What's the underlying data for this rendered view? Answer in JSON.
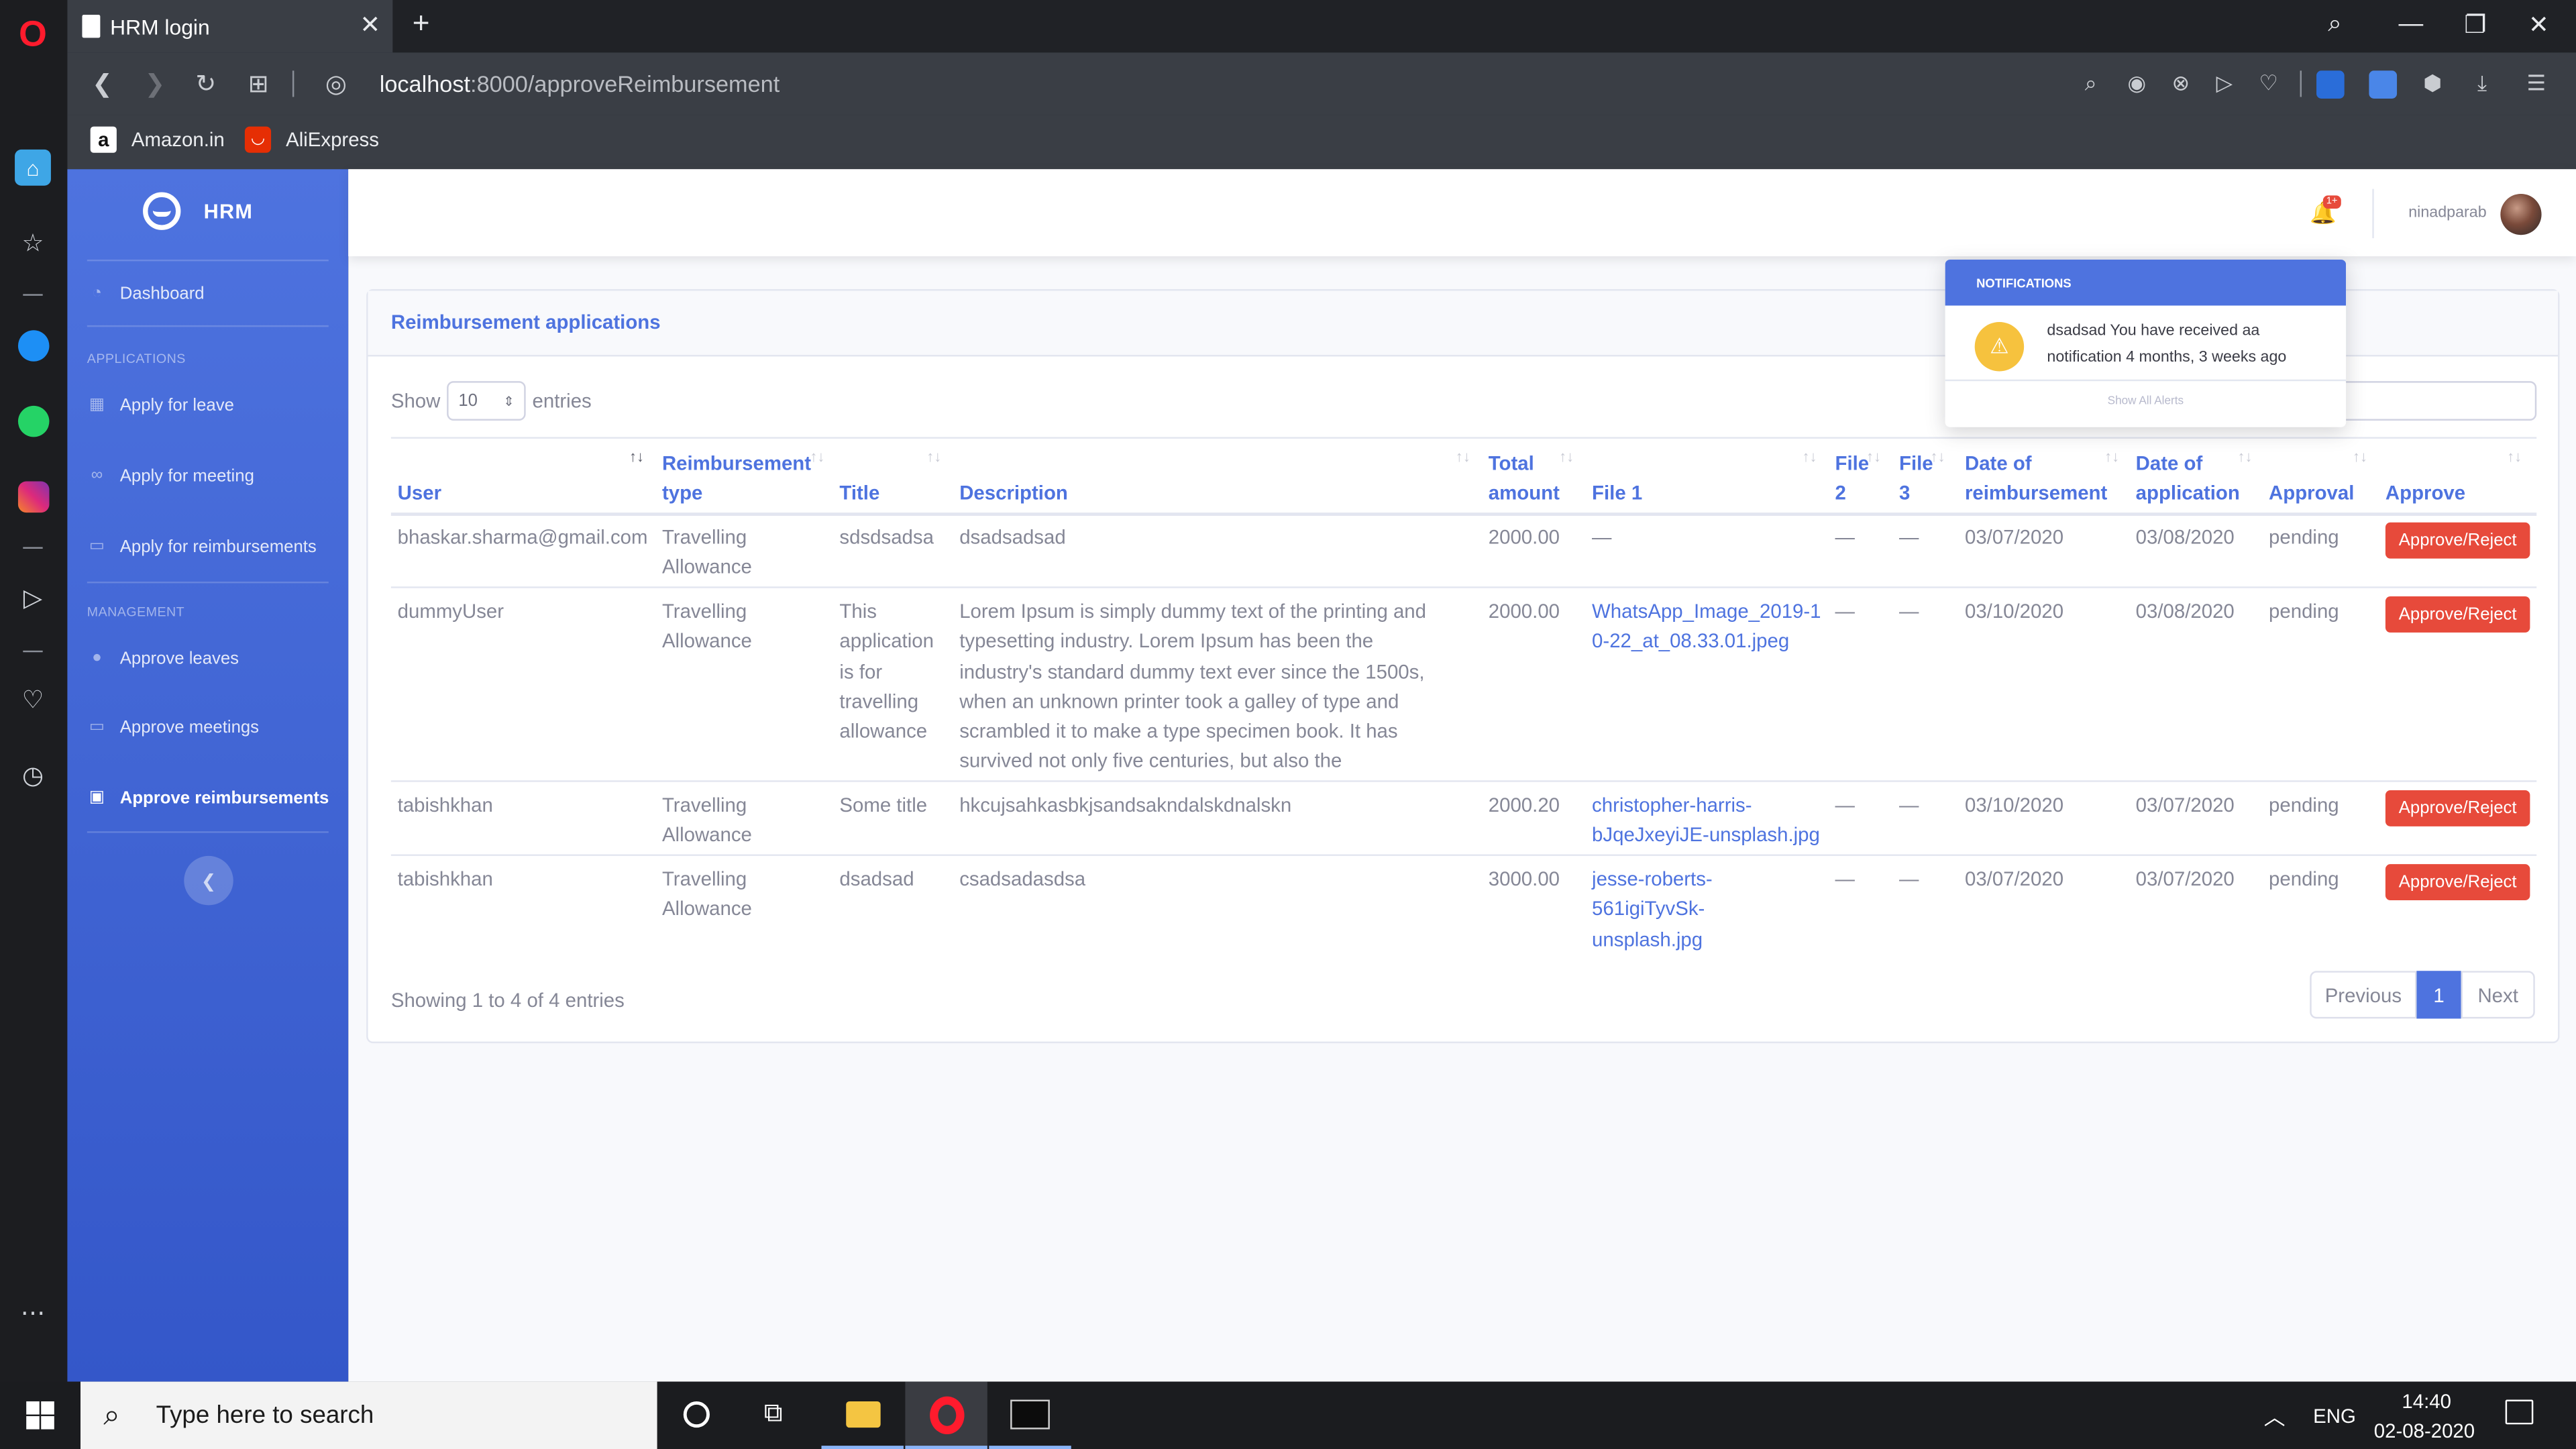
{
  "browser": {
    "tab_title": "HRM login",
    "new_tab": "+",
    "url_host": "localhost",
    "url_path": ":8000/approveReimbursement",
    "bookmarks": [
      {
        "label": "Amazon.in",
        "icon": "amazon-icon"
      },
      {
        "label": "AliExpress",
        "icon": "aliexpress-icon"
      }
    ]
  },
  "app": {
    "brand": "HRM",
    "sidebar": {
      "dashboard": "Dashboard",
      "applications_heading": "APPLICATIONS",
      "apply_leave": "Apply for leave",
      "apply_meeting": "Apply for meeting",
      "apply_reimbursements": "Apply for reimbursements",
      "management_heading": "MANAGEMENT",
      "approve_leaves": "Approve leaves",
      "approve_meetings": "Approve meetings",
      "approve_reimbursements": "Approve reimbursements"
    },
    "topbar": {
      "notification_badge": "1+",
      "username": "ninadparab"
    },
    "notifications": {
      "header": "NOTIFICATIONS",
      "item_text": "dsadsad You have received aa notification 4 months, 3 weeks ago",
      "show_all": "Show All Alerts"
    }
  },
  "page": {
    "card_title": "Reimbursement applications",
    "show_label": "Show",
    "entries_value": "10",
    "entries_label": "entries",
    "columns": {
      "user": "User",
      "type_1": "Reimbursement",
      "type_2": "type",
      "title": "Title",
      "description": "Description",
      "amount_1": "Total",
      "amount_2": "amount",
      "file1": "File 1",
      "file2_1": "File",
      "file2_2": "2",
      "file3_1": "File",
      "file3_2": "3",
      "dor_1": "Date of",
      "dor_2": "reimbursement",
      "doa_1": "Date of",
      "doa_2": "application",
      "approval": "Approval",
      "approve": "Approve"
    },
    "rows": [
      {
        "user": "bhaskar.sharma@gmail.com",
        "type": "Travelling Allowance",
        "title": "sdsdsadsa",
        "description": "dsadsadsad",
        "amount": "2000.00",
        "file1": "—",
        "file2": "—",
        "file3": "—",
        "dor": "03/07/2020",
        "doa": "03/08/2020",
        "approval": "pending",
        "action": "Approve/Reject"
      },
      {
        "user": "dummyUser",
        "type": "Travelling Allowance",
        "title": "This application is for travelling allowance",
        "description": "Lorem Ipsum is simply dummy text of the printing and typesetting industry. Lorem Ipsum has been the industry's standard dummy text ever since the 1500s, when an unknown printer took a galley of type and scrambled it to make a type specimen book. It has survived not only five centuries, but also the",
        "amount": "2000.00",
        "file1": "WhatsApp_Image_2019-10-22_at_08.33.01.jpeg",
        "file2": "—",
        "file3": "—",
        "dor": "03/10/2020",
        "doa": "03/08/2020",
        "approval": "pending",
        "action": "Approve/Reject"
      },
      {
        "user": "tabishkhan",
        "type": "Travelling Allowance",
        "title": "Some title",
        "description": "hkcujsahkasbkjsandsakndalskdnalskn",
        "amount": "2000.20",
        "file1": "christopher-harris-bJqeJxeyiJE-unsplash.jpg",
        "file2": "—",
        "file3": "—",
        "dor": "03/10/2020",
        "doa": "03/07/2020",
        "approval": "pending",
        "action": "Approve/Reject"
      },
      {
        "user": "tabishkhan",
        "type": "Travelling Allowance",
        "title": "dsadsad",
        "description": "csadsadasdsa",
        "amount": "3000.00",
        "file1": "jesse-roberts-561igiTyvSk-unsplash.jpg",
        "file2": "—",
        "file3": "—",
        "dor": "03/07/2020",
        "doa": "03/07/2020",
        "approval": "pending",
        "action": "Approve/Reject"
      }
    ],
    "info": "Showing 1 to 4 of 4 entries",
    "pagination": {
      "previous": "Previous",
      "current": "1",
      "next": "Next"
    }
  },
  "taskbar": {
    "search_placeholder": "Type here to search",
    "language": "ENG",
    "time": "14:40",
    "date": "02-08-2020"
  },
  "colors": {
    "primary": "#4e73df",
    "danger": "#e74a3b",
    "warning": "#f6c23e",
    "text": "#858796"
  }
}
